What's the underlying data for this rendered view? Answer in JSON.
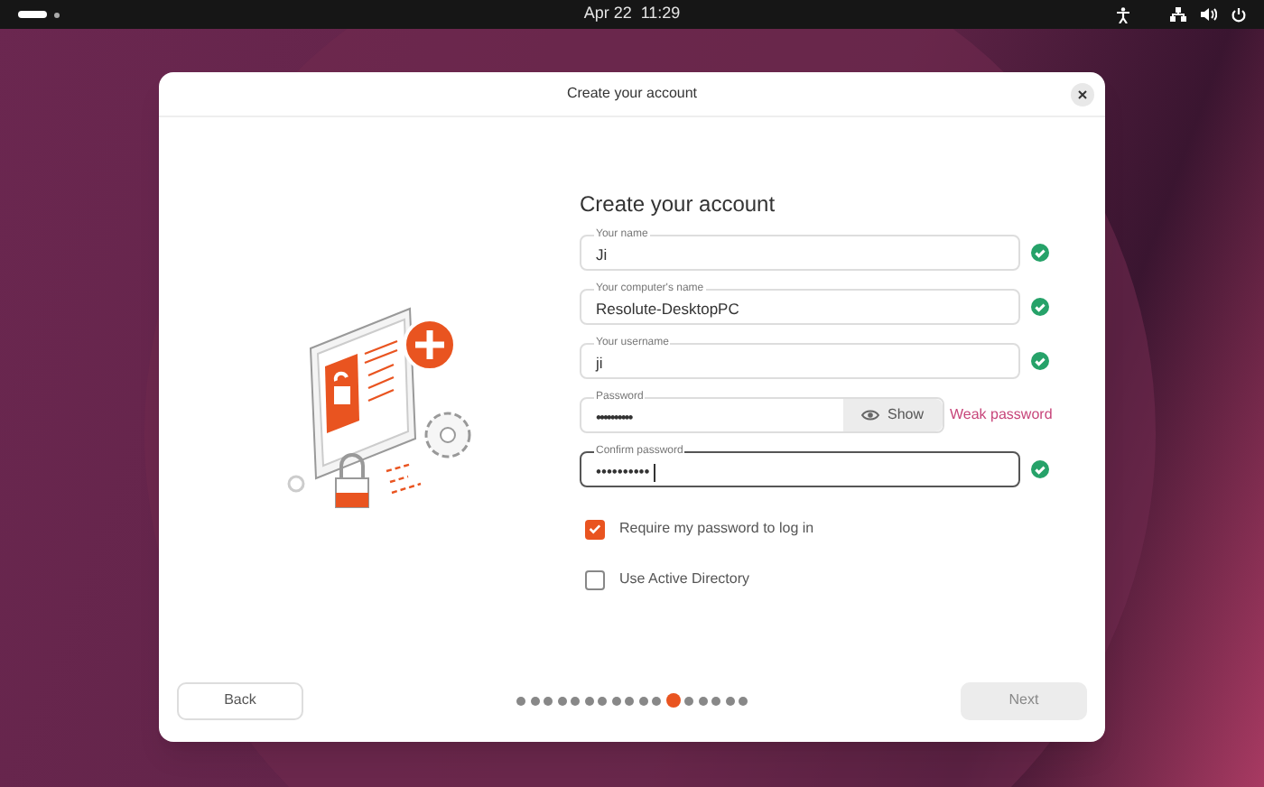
{
  "top_bar": {
    "clock": "Apr 22  11:29"
  },
  "window": {
    "title": "Create your account"
  },
  "form": {
    "heading": "Create your account",
    "fields": [
      {
        "kind": "text",
        "label": "Your name",
        "value": "Ji",
        "valid": true,
        "focused": false
      },
      {
        "kind": "text",
        "label": "Your computer's name",
        "value": "Resolute-DesktopPC",
        "valid": true,
        "focused": false
      },
      {
        "kind": "text",
        "label": "Your username",
        "value": "ji",
        "valid": true,
        "focused": false
      },
      {
        "kind": "password",
        "label": "Password",
        "value": "••••••••••",
        "focused": false,
        "show_button": "Show",
        "strength": "Weak password"
      },
      {
        "kind": "text",
        "label": "Confirm password",
        "value": "••••••••••",
        "valid": true,
        "focused": true
      }
    ],
    "checkboxes": [
      {
        "label": "Require my password to log in",
        "checked": true
      },
      {
        "label": "Use Active Directory",
        "checked": false
      }
    ]
  },
  "footer": {
    "back": "Back",
    "next": "Next",
    "next_disabled": true,
    "steps": [
      {
        "selected": false
      },
      {
        "selected": false
      },
      {
        "selected": false
      },
      {
        "selected": false
      },
      {
        "selected": false
      },
      {
        "selected": false
      },
      {
        "selected": false
      },
      {
        "selected": false
      },
      {
        "selected": false
      },
      {
        "selected": false
      },
      {
        "selected": false
      },
      {
        "selected": true
      },
      {
        "selected": false
      },
      {
        "selected": false
      },
      {
        "selected": false
      },
      {
        "selected": false
      },
      {
        "selected": false
      }
    ]
  }
}
